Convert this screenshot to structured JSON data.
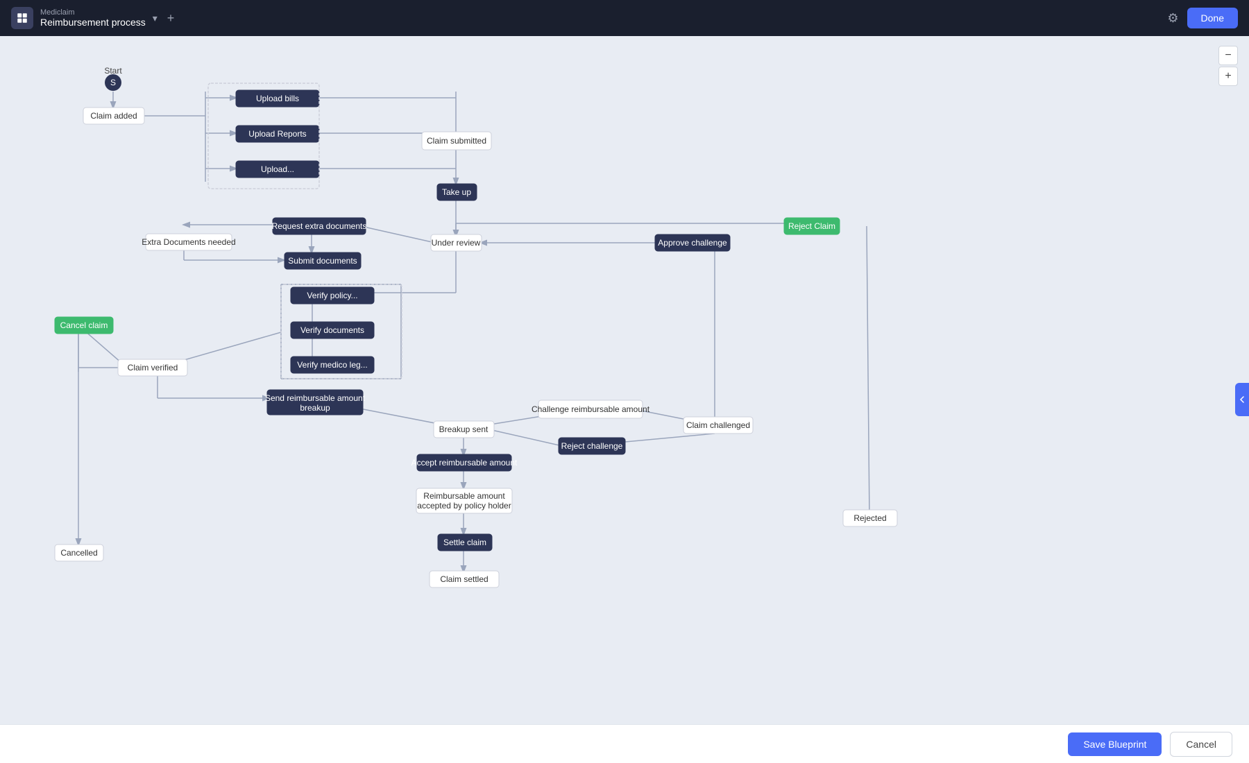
{
  "header": {
    "app_name": "Mediclaim",
    "page_title": "Reimbursement process",
    "done_label": "Done"
  },
  "bottom_bar": {
    "save_label": "Save Blueprint",
    "cancel_label": "Cancel"
  },
  "nodes": {
    "start": "Start",
    "claim_added": "Claim added",
    "upload_bills": "Upload bills",
    "upload_reports": "Upload Reports",
    "upload_more": "Upload...",
    "claim_submitted": "Claim submitted",
    "take_up": "Take up",
    "under_review": "Under review",
    "request_extra_docs": "Request extra documents",
    "extra_docs_needed": "Extra Documents needed",
    "submit_documents": "Submit documents",
    "verify_policy": "Verify policy...",
    "verify_documents": "Verify documents",
    "verify_medico": "Verify medico leg...",
    "cancel_claim": "Cancel claim",
    "claim_verified": "Claim verified",
    "send_breakup": "Send reimbursable amount breakup",
    "challenge_amount": "Challenge reimbursable amount",
    "breakup_sent": "Breakup sent",
    "claim_challenged": "Claim challenged",
    "reject_challenge": "Reject challenge",
    "approve_challenge": "Approve challenge",
    "reject_claim": "Reject Claim",
    "accept_reimbursable": "Accept reimbursable amount",
    "reimbursable_accepted": "Reimbursable amount accepted by policy holder",
    "settle_claim": "Settle claim",
    "claim_settled": "Claim settled",
    "cancelled": "Cancelled",
    "rejected": "Rejected"
  }
}
